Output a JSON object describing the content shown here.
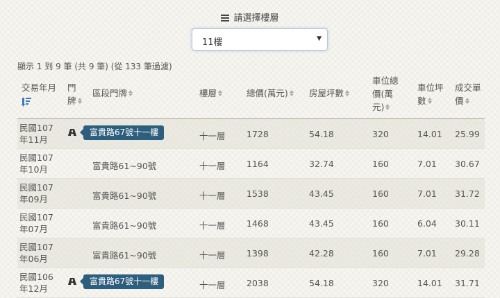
{
  "floor_select": {
    "title": "請選擇樓層",
    "selected": "11樓"
  },
  "summary": "顯示 1 到 9 筆 (共 9 筆) (從 133 筆過濾)",
  "columns": {
    "date_l1": "交易年月",
    "plate_l1": "門",
    "plate_l2": "牌",
    "address": "區段門牌",
    "floor": "樓層",
    "price": "總價(萬元)",
    "area": "房屋坪數",
    "park_l1": "車位總",
    "park_l2": "價(萬",
    "park_l3": "元)",
    "parkarea_l1": "車位坪",
    "parkarea_l2": "數",
    "unit_l1": "成交單",
    "unit_l2": "價"
  },
  "rows": [
    {
      "date_l1": "民國107",
      "date_l2": "年11月",
      "address": "富貴路67號十一樓",
      "has_plate": true,
      "floor": "十一層",
      "price": "1728",
      "area": "54.18",
      "park_price": "320",
      "park_area": "14.01",
      "unit_price": "25.99"
    },
    {
      "date_l1": "民國107",
      "date_l2": "年10月",
      "address": "富貴路61~90號",
      "has_plate": false,
      "floor": "十一層",
      "price": "1164",
      "area": "32.74",
      "park_price": "160",
      "park_area": "7.01",
      "unit_price": "30.67"
    },
    {
      "date_l1": "民國107",
      "date_l2": "年09月",
      "address": "富貴路61~90號",
      "has_plate": false,
      "floor": "十一層",
      "price": "1538",
      "area": "43.45",
      "park_price": "160",
      "park_area": "7.01",
      "unit_price": "31.72"
    },
    {
      "date_l1": "民國107",
      "date_l2": "年07月",
      "address": "富貴路61~90號",
      "has_plate": false,
      "floor": "十一層",
      "price": "1468",
      "area": "43.45",
      "park_price": "160",
      "park_area": "6.04",
      "unit_price": "30.11"
    },
    {
      "date_l1": "民國107",
      "date_l2": "年06月",
      "address": "富貴路61~90號",
      "has_plate": false,
      "floor": "十一層",
      "price": "1398",
      "area": "42.28",
      "park_price": "160",
      "park_area": "7.01",
      "unit_price": "29.28"
    },
    {
      "date_l1": "民國106",
      "date_l2": "年12月",
      "address": "富貴路67號十一樓",
      "has_plate": true,
      "floor": "十一層",
      "price": "2038",
      "area": "54.18",
      "park_price": "320",
      "park_area": "14.01",
      "unit_price": "31.71"
    }
  ],
  "icons": {
    "list": "list-icon",
    "sort": "sort-icon",
    "sort_desc": "sort-desc-icon",
    "plate": "car-icon"
  },
  "colors": {
    "badge": "#2d5e7e",
    "sort_active": "#3a78c2"
  }
}
